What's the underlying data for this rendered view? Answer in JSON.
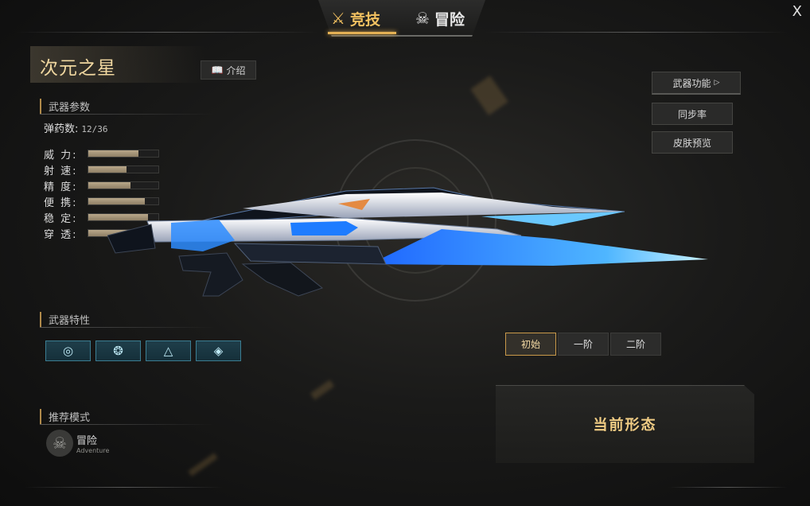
{
  "tabs": [
    {
      "label": "竞技",
      "icon": "crossed-swords-icon",
      "active": true
    },
    {
      "label": "冒险",
      "icon": "skull-icon",
      "active": false
    }
  ],
  "close_label": "X",
  "weapon": {
    "name": "次元之星",
    "intro_label": "介绍"
  },
  "params": {
    "title": "武器参数",
    "ammo_label": "弹药数:",
    "ammo_value": "12/36",
    "stats": [
      {
        "label": "威 力:",
        "value": 0.72
      },
      {
        "label": "射 速:",
        "value": 0.54
      },
      {
        "label": "精 度:",
        "value": 0.6
      },
      {
        "label": "便 携:",
        "value": 0.81
      },
      {
        "label": "稳 定:",
        "value": 0.85
      },
      {
        "label": "穿 透:",
        "value": 0.67
      }
    ]
  },
  "traits": {
    "title": "武器特性",
    "icons": [
      "trait-target-icon",
      "trait-shield-icon",
      "trait-triangle-icon",
      "trait-diamond-icon"
    ]
  },
  "mode": {
    "title": "推荐模式",
    "name": "冒险",
    "sub": "Adventure"
  },
  "right_menu": {
    "function_label": "武器功能",
    "sync_label": "同步率",
    "skin_label": "皮肤预览"
  },
  "stages": [
    {
      "label": "初始",
      "active": true
    },
    {
      "label": "一阶",
      "active": false
    },
    {
      "label": "二阶",
      "active": false
    }
  ],
  "current_form_label": "当前形态",
  "colors": {
    "accent": "#e4b154",
    "trait_blue": "#3b7d92"
  }
}
